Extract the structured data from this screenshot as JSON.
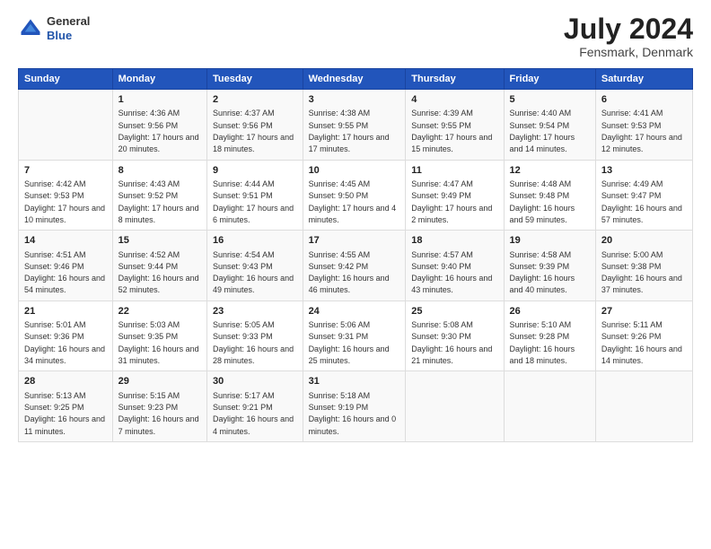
{
  "logo": {
    "general": "General",
    "blue": "Blue"
  },
  "title": "July 2024",
  "location": "Fensmark, Denmark",
  "headers": [
    "Sunday",
    "Monday",
    "Tuesday",
    "Wednesday",
    "Thursday",
    "Friday",
    "Saturday"
  ],
  "weeks": [
    [
      {
        "date": "",
        "sunrise": "",
        "sunset": "",
        "daylight": ""
      },
      {
        "date": "1",
        "sunrise": "Sunrise: 4:36 AM",
        "sunset": "Sunset: 9:56 PM",
        "daylight": "Daylight: 17 hours and 20 minutes."
      },
      {
        "date": "2",
        "sunrise": "Sunrise: 4:37 AM",
        "sunset": "Sunset: 9:56 PM",
        "daylight": "Daylight: 17 hours and 18 minutes."
      },
      {
        "date": "3",
        "sunrise": "Sunrise: 4:38 AM",
        "sunset": "Sunset: 9:55 PM",
        "daylight": "Daylight: 17 hours and 17 minutes."
      },
      {
        "date": "4",
        "sunrise": "Sunrise: 4:39 AM",
        "sunset": "Sunset: 9:55 PM",
        "daylight": "Daylight: 17 hours and 15 minutes."
      },
      {
        "date": "5",
        "sunrise": "Sunrise: 4:40 AM",
        "sunset": "Sunset: 9:54 PM",
        "daylight": "Daylight: 17 hours and 14 minutes."
      },
      {
        "date": "6",
        "sunrise": "Sunrise: 4:41 AM",
        "sunset": "Sunset: 9:53 PM",
        "daylight": "Daylight: 17 hours and 12 minutes."
      }
    ],
    [
      {
        "date": "7",
        "sunrise": "Sunrise: 4:42 AM",
        "sunset": "Sunset: 9:53 PM",
        "daylight": "Daylight: 17 hours and 10 minutes."
      },
      {
        "date": "8",
        "sunrise": "Sunrise: 4:43 AM",
        "sunset": "Sunset: 9:52 PM",
        "daylight": "Daylight: 17 hours and 8 minutes."
      },
      {
        "date": "9",
        "sunrise": "Sunrise: 4:44 AM",
        "sunset": "Sunset: 9:51 PM",
        "daylight": "Daylight: 17 hours and 6 minutes."
      },
      {
        "date": "10",
        "sunrise": "Sunrise: 4:45 AM",
        "sunset": "Sunset: 9:50 PM",
        "daylight": "Daylight: 17 hours and 4 minutes."
      },
      {
        "date": "11",
        "sunrise": "Sunrise: 4:47 AM",
        "sunset": "Sunset: 9:49 PM",
        "daylight": "Daylight: 17 hours and 2 minutes."
      },
      {
        "date": "12",
        "sunrise": "Sunrise: 4:48 AM",
        "sunset": "Sunset: 9:48 PM",
        "daylight": "Daylight: 16 hours and 59 minutes."
      },
      {
        "date": "13",
        "sunrise": "Sunrise: 4:49 AM",
        "sunset": "Sunset: 9:47 PM",
        "daylight": "Daylight: 16 hours and 57 minutes."
      }
    ],
    [
      {
        "date": "14",
        "sunrise": "Sunrise: 4:51 AM",
        "sunset": "Sunset: 9:46 PM",
        "daylight": "Daylight: 16 hours and 54 minutes."
      },
      {
        "date": "15",
        "sunrise": "Sunrise: 4:52 AM",
        "sunset": "Sunset: 9:44 PM",
        "daylight": "Daylight: 16 hours and 52 minutes."
      },
      {
        "date": "16",
        "sunrise": "Sunrise: 4:54 AM",
        "sunset": "Sunset: 9:43 PM",
        "daylight": "Daylight: 16 hours and 49 minutes."
      },
      {
        "date": "17",
        "sunrise": "Sunrise: 4:55 AM",
        "sunset": "Sunset: 9:42 PM",
        "daylight": "Daylight: 16 hours and 46 minutes."
      },
      {
        "date": "18",
        "sunrise": "Sunrise: 4:57 AM",
        "sunset": "Sunset: 9:40 PM",
        "daylight": "Daylight: 16 hours and 43 minutes."
      },
      {
        "date": "19",
        "sunrise": "Sunrise: 4:58 AM",
        "sunset": "Sunset: 9:39 PM",
        "daylight": "Daylight: 16 hours and 40 minutes."
      },
      {
        "date": "20",
        "sunrise": "Sunrise: 5:00 AM",
        "sunset": "Sunset: 9:38 PM",
        "daylight": "Daylight: 16 hours and 37 minutes."
      }
    ],
    [
      {
        "date": "21",
        "sunrise": "Sunrise: 5:01 AM",
        "sunset": "Sunset: 9:36 PM",
        "daylight": "Daylight: 16 hours and 34 minutes."
      },
      {
        "date": "22",
        "sunrise": "Sunrise: 5:03 AM",
        "sunset": "Sunset: 9:35 PM",
        "daylight": "Daylight: 16 hours and 31 minutes."
      },
      {
        "date": "23",
        "sunrise": "Sunrise: 5:05 AM",
        "sunset": "Sunset: 9:33 PM",
        "daylight": "Daylight: 16 hours and 28 minutes."
      },
      {
        "date": "24",
        "sunrise": "Sunrise: 5:06 AM",
        "sunset": "Sunset: 9:31 PM",
        "daylight": "Daylight: 16 hours and 25 minutes."
      },
      {
        "date": "25",
        "sunrise": "Sunrise: 5:08 AM",
        "sunset": "Sunset: 9:30 PM",
        "daylight": "Daylight: 16 hours and 21 minutes."
      },
      {
        "date": "26",
        "sunrise": "Sunrise: 5:10 AM",
        "sunset": "Sunset: 9:28 PM",
        "daylight": "Daylight: 16 hours and 18 minutes."
      },
      {
        "date": "27",
        "sunrise": "Sunrise: 5:11 AM",
        "sunset": "Sunset: 9:26 PM",
        "daylight": "Daylight: 16 hours and 14 minutes."
      }
    ],
    [
      {
        "date": "28",
        "sunrise": "Sunrise: 5:13 AM",
        "sunset": "Sunset: 9:25 PM",
        "daylight": "Daylight: 16 hours and 11 minutes."
      },
      {
        "date": "29",
        "sunrise": "Sunrise: 5:15 AM",
        "sunset": "Sunset: 9:23 PM",
        "daylight": "Daylight: 16 hours and 7 minutes."
      },
      {
        "date": "30",
        "sunrise": "Sunrise: 5:17 AM",
        "sunset": "Sunset: 9:21 PM",
        "daylight": "Daylight: 16 hours and 4 minutes."
      },
      {
        "date": "31",
        "sunrise": "Sunrise: 5:18 AM",
        "sunset": "Sunset: 9:19 PM",
        "daylight": "Daylight: 16 hours and 0 minutes."
      },
      {
        "date": "",
        "sunrise": "",
        "sunset": "",
        "daylight": ""
      },
      {
        "date": "",
        "sunrise": "",
        "sunset": "",
        "daylight": ""
      },
      {
        "date": "",
        "sunrise": "",
        "sunset": "",
        "daylight": ""
      }
    ]
  ]
}
